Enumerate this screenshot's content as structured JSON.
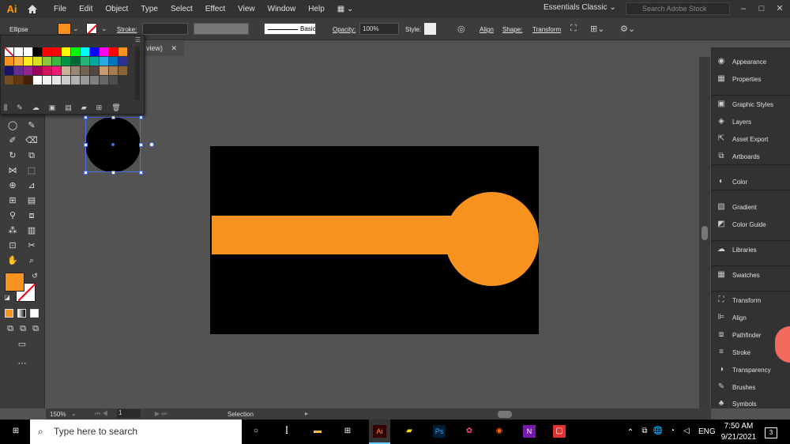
{
  "app": {
    "logo": "Ai"
  },
  "menubar": [
    "File",
    "Edit",
    "Object",
    "Type",
    "Select",
    "Effect",
    "View",
    "Window",
    "Help"
  ],
  "workspace": "Essentials Classic",
  "search_placeholder": "Search Adobe Stock",
  "control": {
    "selection_type": "Ellipse",
    "stroke_label": "Stroke:",
    "brush": "Basic",
    "opacity_label": "Opacity:",
    "opacity_value": "100%",
    "style_label": "Style:",
    "align": "Align",
    "shape": "Shape:",
    "transform": "Transform"
  },
  "doc_tab": "view)",
  "status": {
    "zoom": "150%",
    "artboard": "1",
    "mode": "Selection"
  },
  "right_panel": [
    {
      "label": "Appearance",
      "icon": "appearance-icon"
    },
    {
      "label": "Properties",
      "icon": "properties-icon"
    },
    {
      "label": "Graphic Styles",
      "icon": "graphic-styles-icon"
    },
    {
      "label": "Layers",
      "icon": "layers-icon"
    },
    {
      "label": "Asset Export",
      "icon": "asset-export-icon"
    },
    {
      "label": "Artboards",
      "icon": "artboards-icon"
    },
    {
      "label": "Color",
      "icon": "color-icon"
    },
    {
      "label": "Gradient",
      "icon": "gradient-icon"
    },
    {
      "label": "Color Guide",
      "icon": "color-guide-icon"
    },
    {
      "label": "Libraries",
      "icon": "libraries-icon"
    },
    {
      "label": "Swatches",
      "icon": "swatches-icon"
    },
    {
      "label": "Transform",
      "icon": "transform-icon"
    },
    {
      "label": "Align",
      "icon": "align-icon"
    },
    {
      "label": "Pathfinder",
      "icon": "pathfinder-icon"
    },
    {
      "label": "Stroke",
      "icon": "stroke-icon"
    },
    {
      "label": "Transparency",
      "icon": "transparency-icon"
    },
    {
      "label": "Brushes",
      "icon": "brushes-icon"
    },
    {
      "label": "Symbols",
      "icon": "symbols-icon"
    }
  ],
  "taskbar": {
    "search": "Type here to search",
    "time": "7:50 AM",
    "date": "9/21/2021",
    "lang": "ENG",
    "notif": "3"
  },
  "colors": {
    "fill": "#f7931e",
    "artboard": "#000000",
    "accent": "#4a6fe8"
  }
}
